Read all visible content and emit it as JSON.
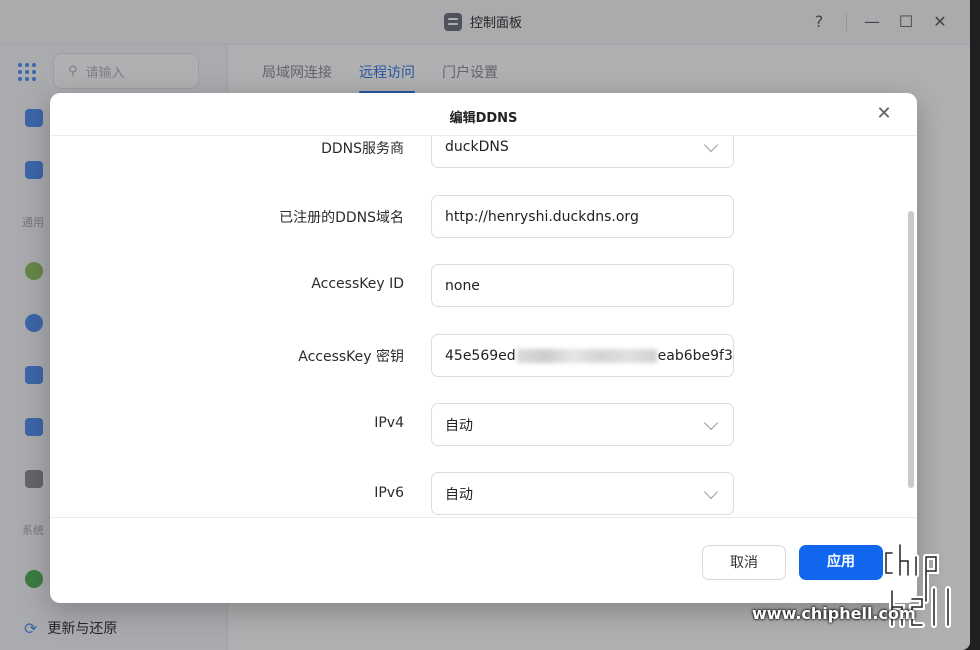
{
  "window": {
    "title": "控制面板",
    "help": "?",
    "minimize": "—",
    "maximize": "☐",
    "close": "✕"
  },
  "sidebar": {
    "search_placeholder": "请输入",
    "group1": "通用",
    "group2": "系统",
    "bottom_item": "更新与还原"
  },
  "tabs": [
    "局域网连接",
    "远程访问",
    "门户设置"
  ],
  "modal": {
    "title": "编辑DDNS",
    "close": "✕",
    "fields": [
      {
        "label": "DDNS服务商",
        "value": "duckDNS",
        "type": "select"
      },
      {
        "label": "已注册的DDNS域名",
        "value": "http://henryshi.duckdns.org",
        "type": "text"
      },
      {
        "label": "AccessKey ID",
        "value": "none",
        "type": "text"
      },
      {
        "label": "AccessKey 密钥",
        "value_start": "45e569ed",
        "value_end": "eab6be9f3",
        "type": "secret"
      },
      {
        "label": "IPv4",
        "value": "自动",
        "type": "select"
      },
      {
        "label": "IPv6",
        "value": "自动",
        "type": "select"
      }
    ],
    "cancel": "取消",
    "apply": "应用"
  },
  "watermark": {
    "url": "www.chiphell.com",
    "logo": "chip hell"
  },
  "colors": {
    "accent": "#1066ec",
    "tab_active": "#2f76e8"
  }
}
